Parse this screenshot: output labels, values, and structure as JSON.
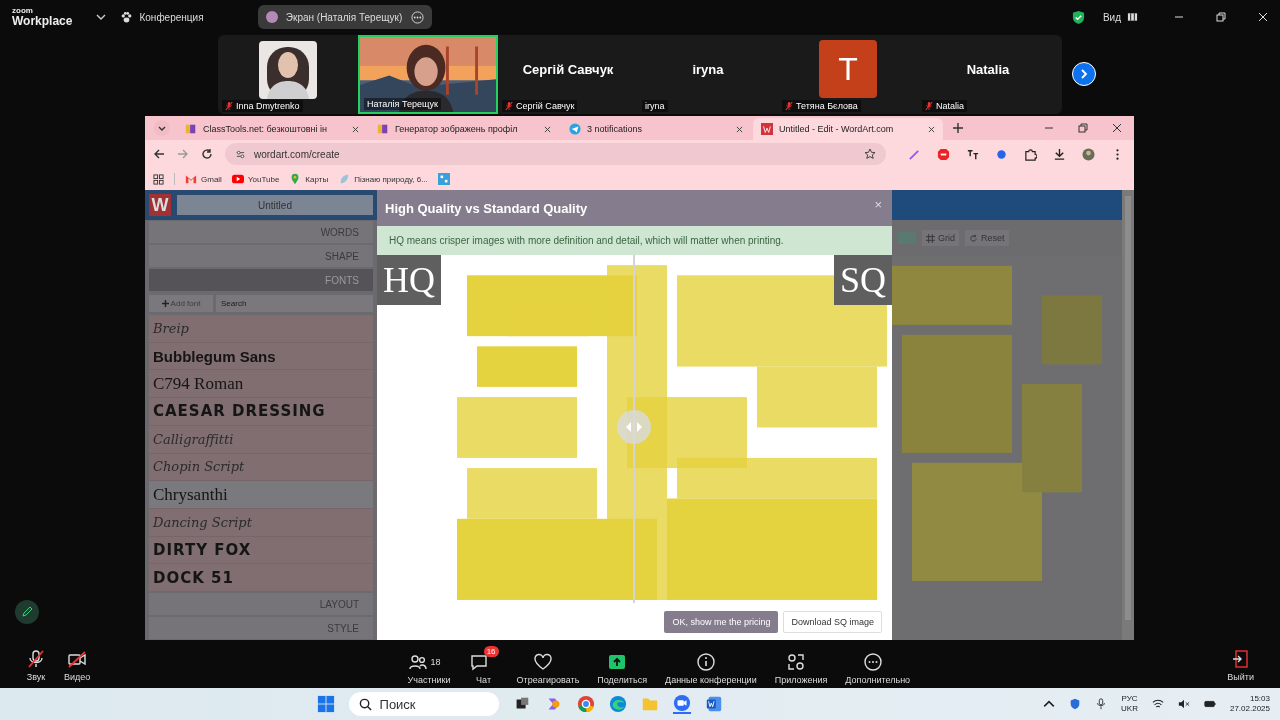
{
  "zoom_top_bar": {
    "app_name": "zoom",
    "app_subtitle": "Workplace",
    "meeting_menu": "Конференция",
    "share_pill": "Экран (Наталія Терещук)",
    "view_menu": "Вид"
  },
  "participants": [
    {
      "name": "Inna Dmytrenko",
      "muted": true,
      "selected": false
    },
    {
      "name": "Наталія Терещук",
      "kind": "video",
      "muted": false,
      "selected": true
    },
    {
      "name": "Сергій Савчук",
      "kind": "name",
      "display": "Сергій Савчук",
      "muted": true,
      "selected": false
    },
    {
      "name": "iryna",
      "kind": "name",
      "display": "iryna",
      "muted": false,
      "selected": false
    },
    {
      "name": "Тетяна Бєлова",
      "kind": "letter",
      "display": "T",
      "color": "#c4401a",
      "muted": true,
      "selected": false
    },
    {
      "name": "Natalia",
      "kind": "name",
      "display": "Natalia",
      "muted": true,
      "selected": false
    }
  ],
  "browser": {
    "tabs": [
      {
        "title": "ClassTools.net: безкоштовні ін",
        "kind": "blocks",
        "selected": false
      },
      {
        "title": "Генератор зображень профіл",
        "kind": "blocks",
        "selected": false
      },
      {
        "title": "3 notifications",
        "kind": "plane",
        "selected": false
      },
      {
        "title": "Untitled - Edit - WordArt.com",
        "kind": "letter",
        "selected": true
      }
    ],
    "address": "wordart.com/create",
    "bookmarks": [
      {
        "label": "Gmail",
        "kind": "mail"
      },
      {
        "label": "YouTube",
        "kind": "play"
      },
      {
        "label": "Карты",
        "kind": "pin"
      },
      {
        "label": "Пізнаю природу, 6...",
        "kind": "leaf"
      }
    ]
  },
  "wordart": {
    "logo": "W",
    "doc_title": "Untitled",
    "menu_top": [
      {
        "label": "WORDS",
        "selected": false
      },
      {
        "label": "SHAPE",
        "selected": false
      },
      {
        "label": "FONTS",
        "selected": true
      }
    ],
    "add_font": "Add font",
    "font_search_placeholder": "Search",
    "fonts": [
      {
        "name": "Breip",
        "kind": "script",
        "selected": false
      },
      {
        "name": "Bubblegum Sans",
        "kind": "bold",
        "selected": false
      },
      {
        "name": "C794 Roman",
        "kind": "serif",
        "selected": false
      },
      {
        "name": "CAESAR DRESSING",
        "kind": "caps",
        "selected": false
      },
      {
        "name": "Calligraffitti",
        "kind": "script",
        "selected": false
      },
      {
        "name": "Chopin Script",
        "kind": "script",
        "selected": false
      },
      {
        "name": "Chrysanthi",
        "kind": "serif",
        "selected": true
      },
      {
        "name": "Dancing Script",
        "kind": "script",
        "selected": false
      },
      {
        "name": "DIRTY FOX",
        "kind": "caps",
        "selected": false
      },
      {
        "name": "DOCK 51",
        "kind": "caps",
        "selected": false
      }
    ],
    "menu_bottom": [
      {
        "label": "LAYOUT",
        "selected": false
      },
      {
        "label": "STYLE",
        "selected": false
      }
    ],
    "toolbar": {
      "grid": "Grid",
      "reset": "Reset"
    }
  },
  "modal": {
    "title": "High Quality vs Standard Quality",
    "close": "×",
    "note": "HQ means crisper images with more definition and detail, which will matter when printing.",
    "hq_label": "HQ",
    "sq_label": "SQ",
    "primary_button": "OK, show me the pricing",
    "secondary_button": "Download SQ image"
  },
  "zoom_toolbar": {
    "left": [
      {
        "label": "Звук",
        "kind": "mic",
        "off": true
      },
      {
        "label": "Видео",
        "kind": "video",
        "off": true
      }
    ],
    "center": [
      {
        "label": "Участники",
        "kind": "people",
        "count": "18"
      },
      {
        "label": "Чат",
        "kind": "chat",
        "badge": "16"
      },
      {
        "label": "Отреагировать",
        "kind": "heart"
      },
      {
        "label": "Поделиться",
        "kind": "share"
      },
      {
        "label": "Данные конференции",
        "kind": "info"
      },
      {
        "label": "Приложения",
        "kind": "apps"
      },
      {
        "label": "Дополнительно",
        "kind": "more"
      }
    ],
    "leave": "Выйти"
  },
  "taskbar": {
    "search_placeholder": "Поиск",
    "lang": "РУС",
    "layout": "UKR",
    "time": "15:03",
    "date": "27.02.2025"
  }
}
